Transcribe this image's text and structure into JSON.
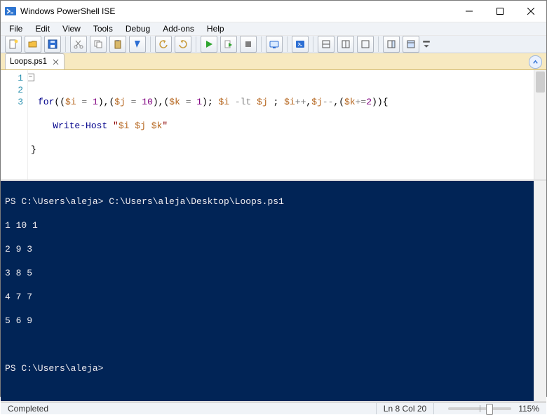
{
  "window": {
    "title": "Windows PowerShell ISE"
  },
  "menu": {
    "items": [
      "File",
      "Edit",
      "View",
      "Tools",
      "Debug",
      "Add-ons",
      "Help"
    ]
  },
  "tab": {
    "label": "Loops.ps1"
  },
  "gutter": {
    "l1": "1",
    "l2": "2",
    "l3": "3"
  },
  "code": {
    "l1_for": "for",
    "l1_p1": "((",
    "l1_vi": "$i",
    "l1_eq1": " = ",
    "l1_n1": "1",
    "l1_c1": "),(",
    "l1_vj": "$j",
    "l1_eq2": " = ",
    "l1_n10": "10",
    "l1_c2": "),(",
    "l1_vk": "$k",
    "l1_eq3": " = ",
    "l1_n1b": "1",
    "l1_c3": "); ",
    "l1_vi2": "$i",
    "l1_lt": " -lt ",
    "l1_vj2": "$j",
    "l1_c4": " ; ",
    "l1_vi3": "$i",
    "l1_inc": "++",
    "l1_c5": ",",
    "l1_vj3": "$j",
    "l1_dec": "--",
    "l1_c6": ",(",
    "l1_vk2": "$k",
    "l1_pe": "+=",
    "l1_n2": "2",
    "l1_c7": ")){",
    "l2_indent": "    ",
    "l2_wh": "Write-Host",
    "l2_sp": " ",
    "l2_q1": "\"",
    "l2_vi": "$i",
    "l2_s1": " ",
    "l2_vj": "$j",
    "l2_s2": " ",
    "l2_vk": "$k",
    "l2_q2": "\"",
    "l3": "}"
  },
  "console": {
    "line0": "PS C:\\Users\\aleja> C:\\Users\\aleja\\Desktop\\Loops.ps1",
    "line1": "1 10 1",
    "line2": "2 9 3",
    "line3": "3 8 5",
    "line4": "4 7 7",
    "line5": "5 6 9",
    "blank": " ",
    "prompt": "PS C:\\Users\\aleja> "
  },
  "status": {
    "completed": "Completed",
    "position": "Ln 8  Col 20",
    "zoom": "115%"
  }
}
